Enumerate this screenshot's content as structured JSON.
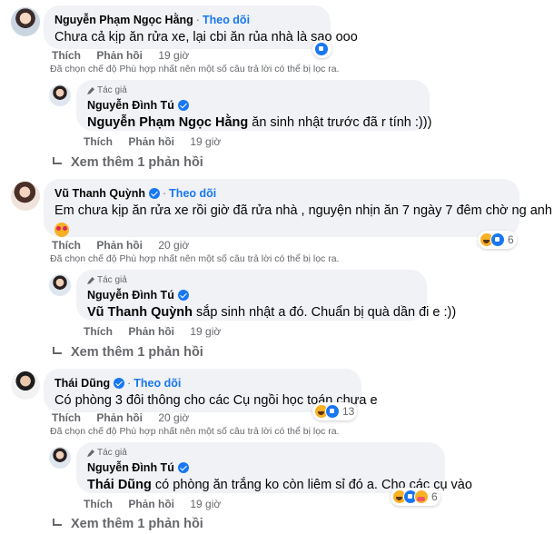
{
  "actions": {
    "like": "Thích",
    "reply": "Phản hồi"
  },
  "follow_label": "Theo dõi",
  "author_badge": "Tác giả",
  "filter_notice": "Đã chọn chế độ Phù hợp nhất nên một số câu trả lời có thể bị lọc ra.",
  "see_more": "Xem thêm 1 phản hồi",
  "threads": [
    {
      "comment": {
        "name": "Nguyễn Phạm Ngọc Hằng",
        "text": "Chưa cả kịp ăn rửa xe, lại cbi ăn rủa nhà là sao ooo",
        "time": "19 giờ",
        "reactions": [
          "like"
        ],
        "count": ""
      },
      "reply": {
        "name": "Nguyễn Đình Tú",
        "tag": "Nguyễn Phạm Ngọc Hằng",
        "text": " ăn sinh nhật trước đã r tính :)))",
        "time": "19 giờ"
      }
    },
    {
      "comment": {
        "name": "Vũ Thanh Quỳnh",
        "text": "Em chưa kịp ăn rửa xe rồi giờ đã rửa nhà , nguyện nhịn ăn 7 ngày 7 đêm chờ ng anh",
        "time": "20 giờ",
        "reactions": [
          "haha",
          "like"
        ],
        "count": "6"
      },
      "reply": {
        "name": "Nguyễn Đình Tú",
        "tag": "Vũ Thanh Quỳnh",
        "text": " sắp sinh nhật a đó. Chuẩn bị quà dần đi e :))",
        "time": "19 giờ"
      }
    },
    {
      "comment": {
        "name": "Thái Dũng",
        "text": "Có phòng 3 đôi thông cho các Cụ ngồi học toán chưa e",
        "time": "20 giờ",
        "reactions": [
          "haha",
          "like"
        ],
        "count": "13"
      },
      "reply": {
        "name": "Nguyễn Đình Tú",
        "tag": "Thái Dũng",
        "text": " có phòng ăn trắng ko còn liêm sỉ đó a. Cho các cụ vào",
        "time": "19 giờ",
        "reactions": [
          "haha",
          "like",
          "care"
        ],
        "count": "6"
      }
    }
  ]
}
